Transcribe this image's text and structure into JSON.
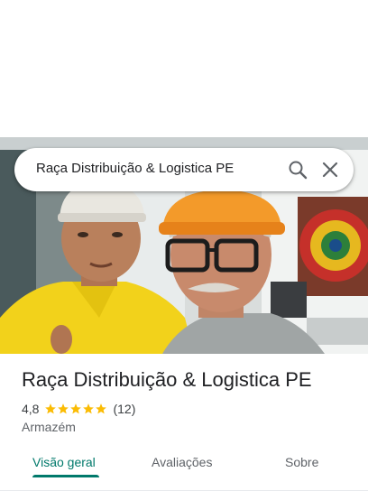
{
  "search": {
    "query": "Raça Distribuição & Logistica PE",
    "search_icon": "search-icon",
    "close_icon": "close-icon"
  },
  "place": {
    "title": "Raça Distribuição & Logistica PE",
    "rating": "4,8",
    "stars": 5,
    "review_count": "(12)",
    "category": "Armazém"
  },
  "tabs": [
    {
      "label": "Visão geral",
      "active": true
    },
    {
      "label": "Avaliações",
      "active": false
    },
    {
      "label": "Sobre",
      "active": false
    }
  ],
  "colors": {
    "accent": "#00796b",
    "star": "#fbbc04",
    "text": "#202124",
    "secondary": "#5f6368"
  }
}
